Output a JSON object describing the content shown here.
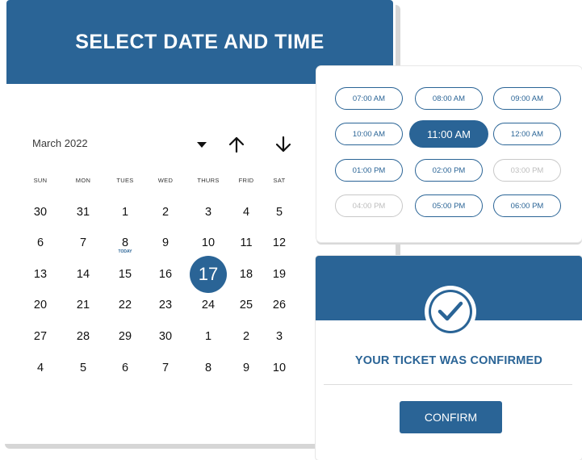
{
  "calendar": {
    "title": "SELECT DATE AND TIME",
    "month": "March 2022",
    "weekdays": [
      "SUN",
      "MON",
      "TUES",
      "WED",
      "THURS",
      "FRID",
      "SAT"
    ],
    "weeks": [
      [
        "30",
        "31",
        "1",
        "2",
        "3",
        "4",
        "5"
      ],
      [
        "6",
        "7",
        "8",
        "9",
        "10",
        "11",
        "12"
      ],
      [
        "13",
        "14",
        "15",
        "16",
        "17",
        "18",
        "19"
      ],
      [
        "20",
        "21",
        "22",
        "23",
        "24",
        "25",
        "26"
      ],
      [
        "27",
        "28",
        "29",
        "30",
        "1",
        "2",
        "3"
      ],
      [
        "4",
        "5",
        "6",
        "7",
        "8",
        "9",
        "10"
      ]
    ],
    "today_label": "TODAY",
    "selected_day": "17"
  },
  "time_slots": [
    {
      "label": "07:00 AM",
      "state": "available"
    },
    {
      "label": "08:00 AM",
      "state": "available"
    },
    {
      "label": "09:00 AM",
      "state": "available"
    },
    {
      "label": "10:00 AM",
      "state": "available"
    },
    {
      "label": "11:00 AM",
      "state": "selected"
    },
    {
      "label": "12:00 AM",
      "state": "available"
    },
    {
      "label": "01:00 PM",
      "state": "available"
    },
    {
      "label": "02:00 PM",
      "state": "available"
    },
    {
      "label": "03:00 PM",
      "state": "disabled"
    },
    {
      "label": "04:00 PM",
      "state": "disabled"
    },
    {
      "label": "05:00 PM",
      "state": "available"
    },
    {
      "label": "06:00 PM",
      "state": "available"
    }
  ],
  "confirmation": {
    "message": "YOUR TICKET WAS CONFIRMED",
    "button_label": "CONFIRM"
  },
  "icons": {
    "dropdown": "caret-down-icon",
    "prev": "arrow-up-icon",
    "next": "arrow-down-icon",
    "check": "check-icon"
  },
  "colors": {
    "accent": "#2a6496",
    "disabled": "#c8c8c8"
  }
}
